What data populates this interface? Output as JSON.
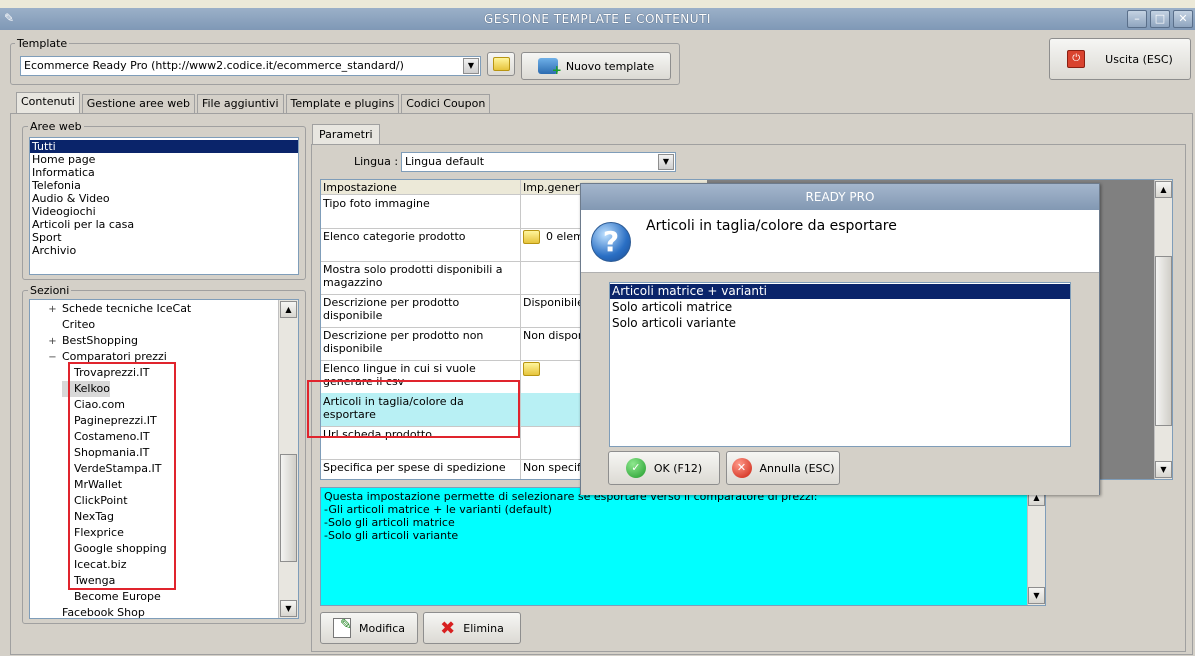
{
  "window": {
    "title": "GESTIONE TEMPLATE E CONTENUTI"
  },
  "template_group": {
    "label": "Template",
    "selected": "Ecommerce Ready Pro (http://www2.codice.it/ecommerce_standard/)",
    "new_template_button": "Nuovo template"
  },
  "exit_button": "Uscita (ESC)",
  "tabs": [
    "Contenuti",
    "Gestione aree web",
    "File aggiuntivi",
    "Template e plugins",
    "Codici Coupon"
  ],
  "aree_web": {
    "label": "Aree web",
    "items": [
      "Tutti",
      "Home page",
      "Informatica",
      "Telefonia",
      "Audio & Video",
      "Videogiochi",
      "Articoli per la casa",
      "Sport",
      "Archivio"
    ],
    "selected_index": 0
  },
  "sezioni": {
    "label": "Sezioni",
    "items": [
      {
        "label": "Schede tecniche IceCat",
        "expander": "+",
        "level": 1
      },
      {
        "label": "Criteo",
        "expander": "",
        "level": 1
      },
      {
        "label": "BestShopping",
        "expander": "+",
        "level": 1
      },
      {
        "label": "Comparatori prezzi",
        "expander": "−",
        "level": 1
      },
      {
        "label": "Trovaprezzi.IT",
        "expander": "",
        "level": 2
      },
      {
        "label": "Kelkoo",
        "expander": "",
        "level": 2
      },
      {
        "label": "Ciao.com",
        "expander": "",
        "level": 2
      },
      {
        "label": "Pagineprezzi.IT",
        "expander": "",
        "level": 2
      },
      {
        "label": "Costameno.IT",
        "expander": "",
        "level": 2
      },
      {
        "label": "Shopmania.IT",
        "expander": "",
        "level": 2
      },
      {
        "label": "VerdeStampa.IT",
        "expander": "",
        "level": 2
      },
      {
        "label": "MrWallet",
        "expander": "",
        "level": 2
      },
      {
        "label": "ClickPoint",
        "expander": "",
        "level": 2
      },
      {
        "label": "NexTag",
        "expander": "",
        "level": 2
      },
      {
        "label": "Flexprice",
        "expander": "",
        "level": 2
      },
      {
        "label": "Google shopping",
        "expander": "",
        "level": 2
      },
      {
        "label": "Icecat.biz",
        "expander": "",
        "level": 2
      },
      {
        "label": "Twenga",
        "expander": "",
        "level": 2
      },
      {
        "label": "Become Europe",
        "expander": "",
        "level": 2
      },
      {
        "label": "Facebook Shop",
        "expander": "",
        "level": 1
      }
    ]
  },
  "parametri": {
    "tab_label": "Parametri",
    "lingua_label": "Lingua :",
    "lingua_value": "Lingua default",
    "columns": [
      "Impostazione",
      "Imp.generica"
    ],
    "rows": [
      {
        "name": "Tipo foto immagine",
        "value": "",
        "folder": false
      },
      {
        "name": "Elenco categorie prodotto",
        "value": "0 elementi",
        "folder": true
      },
      {
        "name": "Mostra solo prodotti disponibili a magazzino",
        "value": "",
        "folder": false
      },
      {
        "name": "Descrizione per prodotto disponibile",
        "value": "Disponibile",
        "folder": false
      },
      {
        "name": "Descrizione per prodotto non disponibile",
        "value": "Non disponibile",
        "folder": false
      },
      {
        "name": "Elenco lingue in cui si vuole generare il csv",
        "value": "",
        "folder": true
      },
      {
        "name": "Articoli in taglia/colore da esportare",
        "value": "",
        "folder": false
      },
      {
        "name": "Url scheda prodotto",
        "value": "",
        "folder": false
      },
      {
        "name": "Specifica per spese di spedizione",
        "value": "Non specificato",
        "folder": false
      }
    ],
    "description_lines": [
      "Questa impostazione permette di selezionare se esportare verso il comparatore di prezzi:",
      "-Gli articoli matrice + le varianti (default)",
      "-Solo gli articoli matrice",
      "-Solo gli articoli variante"
    ],
    "modifica_button": "Modifica",
    "elimina_button": "Elimina"
  },
  "dialog": {
    "title": "READY PRO",
    "question": "Articoli in taglia/colore da esportare",
    "options": [
      "Articoli matrice + varianti",
      "Solo articoli matrice",
      "Solo articoli variante"
    ],
    "selected_index": 0,
    "ok_button": "OK (F12)",
    "cancel_button": "Annulla (ESC)"
  },
  "colors": {
    "highlight_red": "#e0242d",
    "selection_blue": "#0a246a",
    "selected_row": "#b8f0f4",
    "memo_bg": "#00ffff"
  }
}
